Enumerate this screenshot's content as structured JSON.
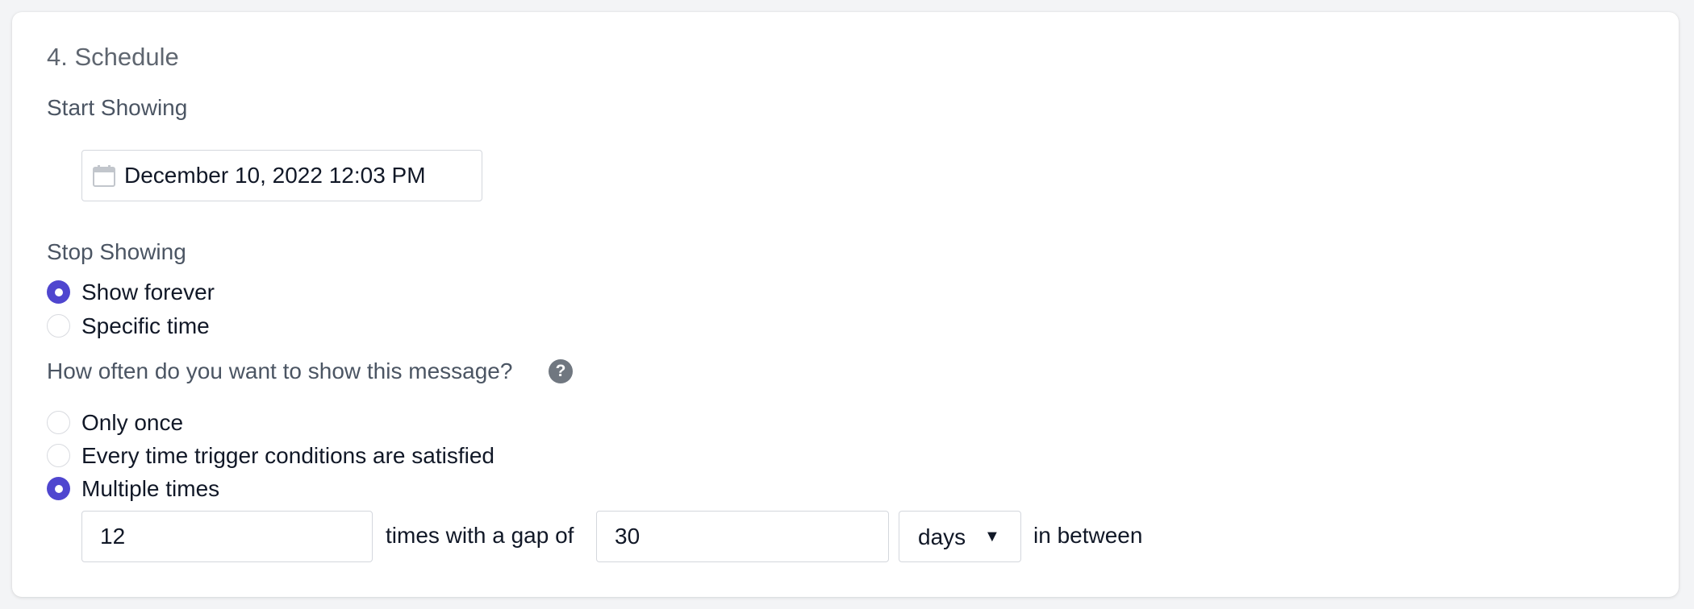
{
  "section": {
    "title": "4. Schedule"
  },
  "start_showing": {
    "label": "Start Showing",
    "date_value": "December 10, 2022 12:03 PM",
    "icon": "calendar-icon"
  },
  "stop_showing": {
    "label": "Stop Showing",
    "options": [
      {
        "label": "Show forever",
        "checked": true
      },
      {
        "label": "Specific time",
        "checked": false
      }
    ]
  },
  "frequency": {
    "label": "How often do you want to show this message?",
    "help_glyph": "?",
    "options": [
      {
        "label": "Only once",
        "checked": false
      },
      {
        "label": "Every time trigger conditions are satisfied",
        "checked": false
      },
      {
        "label": "Multiple times",
        "checked": true
      }
    ],
    "times_value": "12",
    "times_text": "times with a gap of",
    "gap_value": "30",
    "unit_selected": "days",
    "caret_glyph": "▼",
    "suffix_text": "in between"
  },
  "colors": {
    "accent": "#4f46cf",
    "page_bg": "#f3f4f6",
    "label_gray": "#4b5563"
  }
}
